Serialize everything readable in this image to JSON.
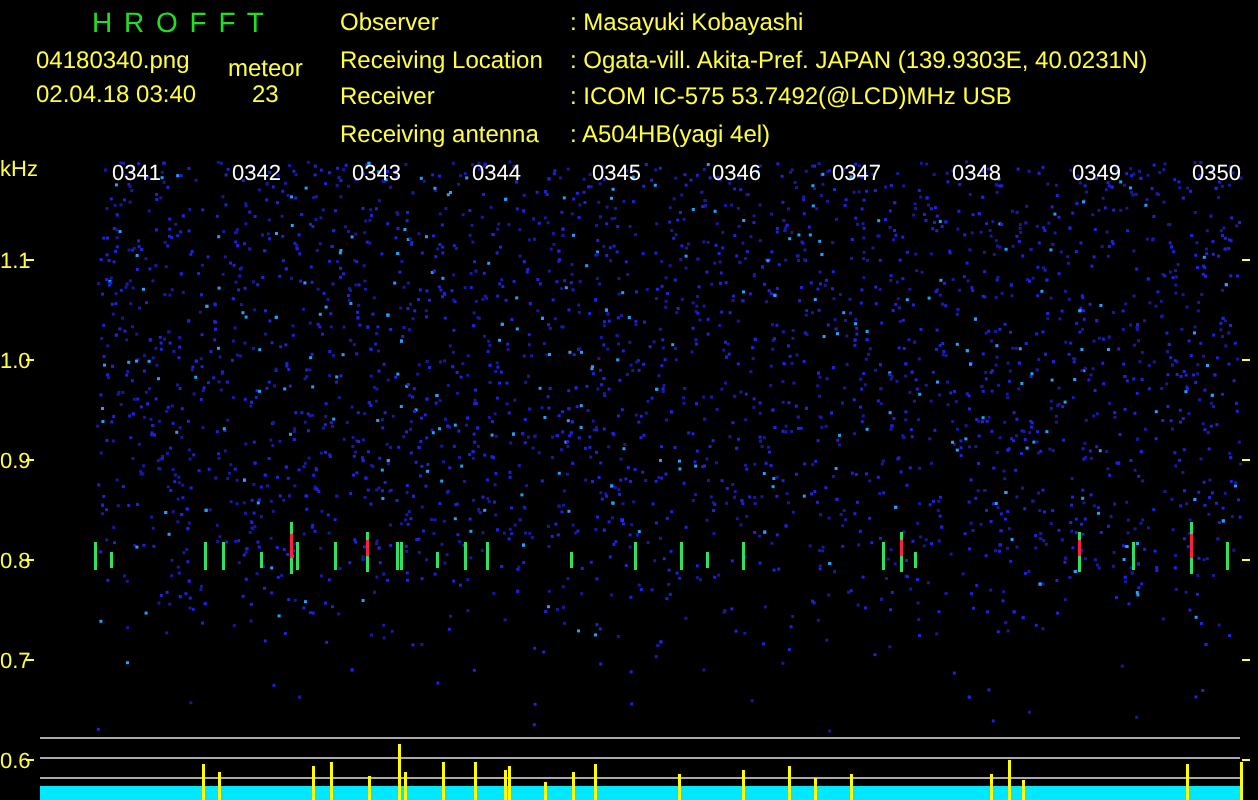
{
  "header": {
    "title": "H R O F F T",
    "file": "04180340.png",
    "datetime": "02.04.18 03:40",
    "meteor_label": "meteor",
    "meteor_count": "23"
  },
  "info": [
    {
      "label": "Observer",
      "value": ": Masayuki Kobayashi"
    },
    {
      "label": "Receiving Location",
      "value": ": Ogata-vill. Akita-Pref. JAPAN (139.9303E, 40.0231N)"
    },
    {
      "label": "Receiver",
      "value": ": ICOM IC-575 53.7492(@LCD)MHz USB"
    },
    {
      "label": "Receiving antenna",
      "value": ": A504HB(yagi 4el)"
    }
  ],
  "spectrogram": {
    "unit": "kHz",
    "time_labels": [
      "0341",
      "0342",
      "0343",
      "0344",
      "0345",
      "0346",
      "0347",
      "0348",
      "0349",
      "0350"
    ],
    "freq_labels": [
      "1.1",
      "1.0",
      "0.9",
      "0.8",
      "0.7",
      "0.6"
    ]
  }
}
